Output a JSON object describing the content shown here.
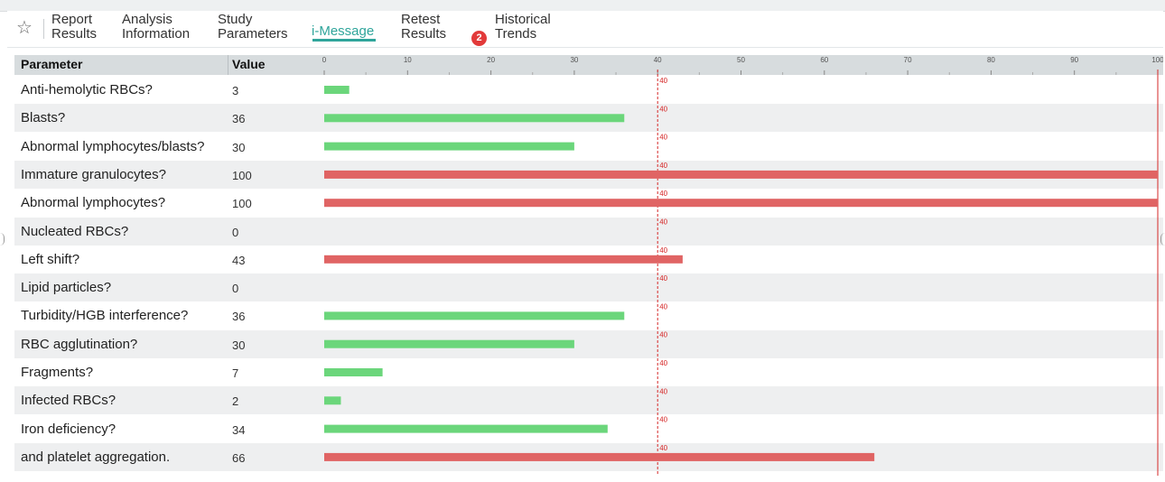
{
  "tabs": [
    {
      "l1": "Report",
      "l2": "Results"
    },
    {
      "l1": "Analysis",
      "l2": "Information"
    },
    {
      "l1": "Study",
      "l2": "Parameters"
    },
    {
      "l1": "i-Message",
      "l2": ""
    },
    {
      "l1": "Retest",
      "l2": "Results"
    },
    {
      "l1": "Historical",
      "l2": "Trends"
    }
  ],
  "active_tab": "i-Message",
  "historical_badge": "2",
  "table": {
    "col_parameter": "Parameter",
    "col_value": "Value"
  },
  "colors": {
    "normal_bar": "#6bd67b",
    "flag_bar": "#e06464",
    "threshold_line": "#d62828",
    "accent": "#2fa59b"
  },
  "chart_data": {
    "type": "bar",
    "orientation": "horizontal",
    "xlim": [
      0,
      100
    ],
    "ticks": [
      "0",
      "10",
      "20",
      "30",
      "40",
      "50",
      "60",
      "70",
      "80",
      "90",
      "100"
    ],
    "threshold": 40,
    "threshold_label": "40",
    "categories": [
      "Anti-hemolytic RBCs?",
      "Blasts?",
      "Abnormal lymphocytes/blasts?",
      "Immature granulocytes?",
      "Abnormal lymphocytes?",
      "Nucleated RBCs?",
      "Left shift?",
      "Lipid particles?",
      "Turbidity/HGB interference?",
      "RBC agglutination?",
      "Fragments?",
      "Infected RBCs?",
      "Iron deficiency?",
      "and platelet aggregation."
    ],
    "values": [
      3,
      36,
      30,
      100,
      100,
      0,
      43,
      0,
      36,
      30,
      7,
      2,
      34,
      66
    ]
  }
}
